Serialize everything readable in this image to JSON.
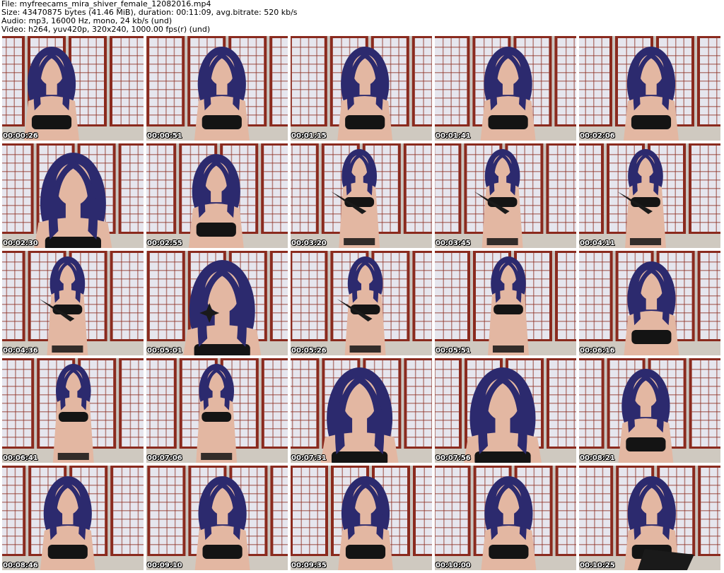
{
  "meta": {
    "file": "File: myfreecams_mira_shiver_female_12082016.mp4",
    "size": "Size: 43470875 bytes (41.46 MiB), duration: 00:11:09, avg.bitrate: 520 kb/s",
    "audio": "Audio: mp3, 16000 Hz, mono, 24 kb/s (und)",
    "video": "Video: h264, yuv420p, 320x240, 1000.00 fps(r) (und)"
  },
  "colors": {
    "screen_frame": "#8a2a1e",
    "screen_panel": "#e6e6ee",
    "wall": "#c9c5bf",
    "floor": "#cfc9c0",
    "hair": "#2c2a6e",
    "skin": "#e3b7a2",
    "garment": "#141414"
  },
  "thumbnails": [
    {
      "timestamp": "00:00:26",
      "pose": "lean-left",
      "prop": "none"
    },
    {
      "timestamp": "00:00:51",
      "pose": "center",
      "prop": "none"
    },
    {
      "timestamp": "00:01:15",
      "pose": "center",
      "prop": "none"
    },
    {
      "timestamp": "00:01:41",
      "pose": "center",
      "prop": "none"
    },
    {
      "timestamp": "00:02:06",
      "pose": "center",
      "prop": "none"
    },
    {
      "timestamp": "00:02:30",
      "pose": "close",
      "prop": "none"
    },
    {
      "timestamp": "00:02:55",
      "pose": "center",
      "prop": "none"
    },
    {
      "timestamp": "00:03:20",
      "pose": "standing",
      "prop": "blade"
    },
    {
      "timestamp": "00:03:45",
      "pose": "standing",
      "prop": "blade"
    },
    {
      "timestamp": "00:04:11",
      "pose": "standing",
      "prop": "blade"
    },
    {
      "timestamp": "00:04:36",
      "pose": "standing",
      "prop": "blade"
    },
    {
      "timestamp": "00:05:01",
      "pose": "close",
      "prop": "star"
    },
    {
      "timestamp": "00:05:26",
      "pose": "standing",
      "prop": "blade"
    },
    {
      "timestamp": "00:05:51",
      "pose": "standing",
      "prop": "none"
    },
    {
      "timestamp": "00:06:16",
      "pose": "center",
      "prop": "none"
    },
    {
      "timestamp": "00:06:41",
      "pose": "standing",
      "prop": "none"
    },
    {
      "timestamp": "00:07:06",
      "pose": "standing",
      "prop": "none"
    },
    {
      "timestamp": "00:07:31",
      "pose": "close",
      "prop": "none"
    },
    {
      "timestamp": "00:07:56",
      "pose": "close",
      "prop": "none"
    },
    {
      "timestamp": "00:08:21",
      "pose": "center",
      "prop": "none"
    },
    {
      "timestamp": "00:08:46",
      "pose": "center",
      "prop": "none"
    },
    {
      "timestamp": "00:09:10",
      "pose": "center",
      "prop": "none"
    },
    {
      "timestamp": "00:09:35",
      "pose": "center",
      "prop": "none"
    },
    {
      "timestamp": "00:10:00",
      "pose": "center",
      "prop": "none"
    },
    {
      "timestamp": "00:10:25",
      "pose": "center",
      "prop": "board"
    }
  ]
}
